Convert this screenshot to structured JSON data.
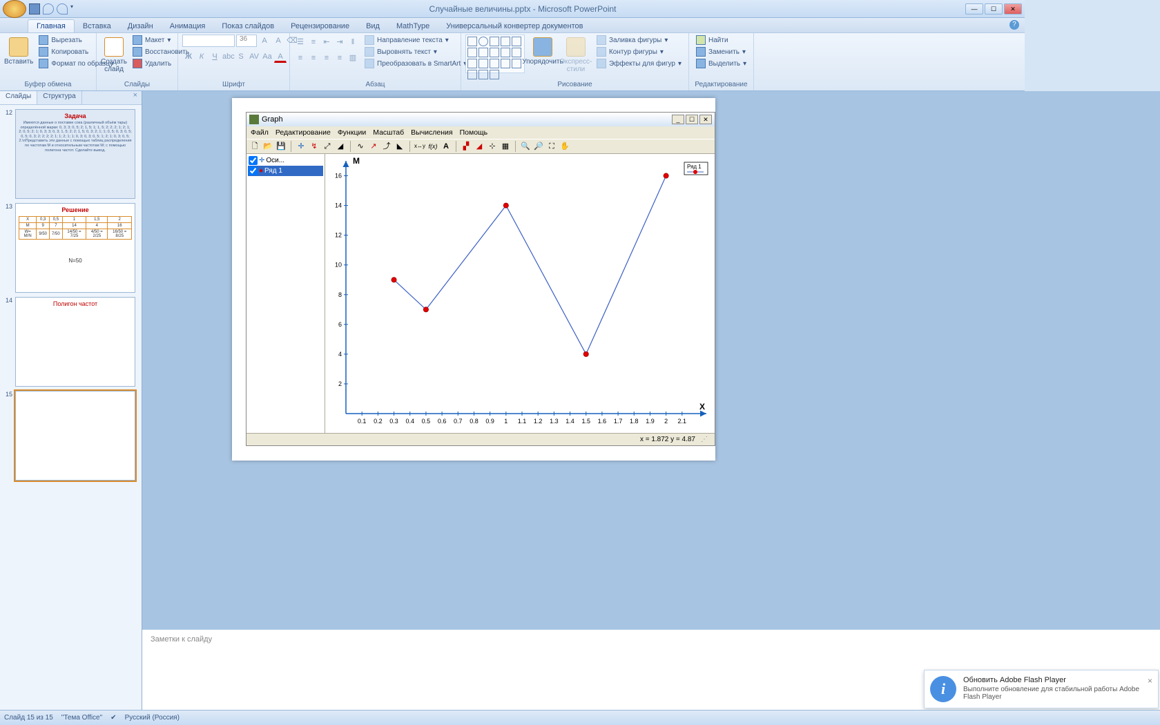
{
  "title": "Случайные величины.pptx - Microsoft PowerPoint",
  "ribbon_tabs": [
    "Главная",
    "Вставка",
    "Дизайн",
    "Анимация",
    "Показ слайдов",
    "Рецензирование",
    "Вид",
    "MathType",
    "Универсальный конвертер документов"
  ],
  "active_tab": 0,
  "clipboard": {
    "paste": "Вставить",
    "cut": "Вырезать",
    "copy": "Копировать",
    "format": "Формат по образцу",
    "label": "Буфер обмена"
  },
  "slides_group": {
    "new": "Создать слайд",
    "layout": "Макет",
    "reset": "Восстановить",
    "delete": "Удалить",
    "label": "Слайды"
  },
  "font_group": {
    "label": "Шрифт",
    "size": "36"
  },
  "paragraph_group": {
    "label": "Абзац",
    "dir": "Направление текста",
    "align": "Выровнять текст",
    "smartart": "Преобразовать в SmartArt"
  },
  "drawing_group": {
    "label": "Рисование",
    "arrange": "Упорядочить",
    "express": "Экспресс-стили",
    "fill": "Заливка фигуры",
    "outline": "Контур фигуры",
    "effects": "Эффекты для фигур"
  },
  "editing_group": {
    "label": "Редактирование",
    "find": "Найти",
    "replace": "Заменить",
    "select": "Выделить"
  },
  "side_tabs": {
    "slides": "Слайды",
    "outline": "Структура"
  },
  "thumbs": [
    {
      "n": 12,
      "title": "Задача",
      "body": "Имеются данные о поставке сока (различный объём тары) определённой марки: 0, 3; 3; 0, 5; 2; 1, 5; 1; 1, 5; 2; 2; 2; 1; 2; 1; 2; 0, 5; 2; 1; 0, 3; 3; 0, 3; 1, 5; 2; 2; 1, 5; 0, 3; 2; 1; 1; 0, 5; 0, 3; 0, 5; 0, 5; 0, 3; 2; 2; 2; 2; 1; 1; 2; 1; 1; 0, 3; 0, 3; 0, 5; 1; 2; 1; 0, 3; 0, 5; 2.\\nПредставить эти данные с помощью таблиц распределения по частотам M и относительным частотам W; с помощью полигона частот. Сделайте вывод."
    },
    {
      "n": 13,
      "title": "Решение",
      "table_header": [
        "X",
        "0,3",
        "0,5",
        "1",
        "1,5",
        "2"
      ],
      "table_m": [
        "M",
        "9",
        "7",
        "14",
        "4",
        "16"
      ],
      "nline": "N=50"
    },
    {
      "n": 14,
      "title": "Полигон частот"
    },
    {
      "n": 15,
      "title": ""
    }
  ],
  "notes_placeholder": "Заметки к слайду",
  "graph_window": {
    "title": "Graph",
    "menu": [
      "Файл",
      "Редактирование",
      "Функции",
      "Масштаб",
      "Вычисления",
      "Помощь"
    ],
    "tree": {
      "axes": "Оси...",
      "series1": "Ряд 1"
    },
    "status": "x = 1.872   y = 4.87",
    "legend": "Ряд 1",
    "xlabel": "X",
    "ylabel": "M"
  },
  "chart_data": {
    "type": "line",
    "title": "",
    "xlabel": "X",
    "ylabel": "M",
    "xlim": [
      0,
      2.2
    ],
    "ylim": [
      0,
      17
    ],
    "x_ticks": [
      0.1,
      0.2,
      0.3,
      0.4,
      0.5,
      0.6,
      0.7,
      0.8,
      0.9,
      1,
      1.1,
      1.2,
      1.3,
      1.4,
      1.5,
      1.6,
      1.7,
      1.8,
      1.9,
      2,
      2.1
    ],
    "y_ticks": [
      2,
      4,
      6,
      8,
      10,
      12,
      14,
      16
    ],
    "series": [
      {
        "name": "Ряд 1",
        "x": [
          0.3,
          0.5,
          1,
          1.5,
          2
        ],
        "y": [
          9,
          7,
          14,
          4,
          16
        ]
      }
    ]
  },
  "statusbar": {
    "slide": "Слайд 15 из 15",
    "theme": "\"Тема Office\"",
    "lang": "Русский (Россия)"
  },
  "notification": {
    "title": "Обновить Adobe Flash Player",
    "body": "Выполните обновление для стабильной работы Adobe Flash Player"
  }
}
